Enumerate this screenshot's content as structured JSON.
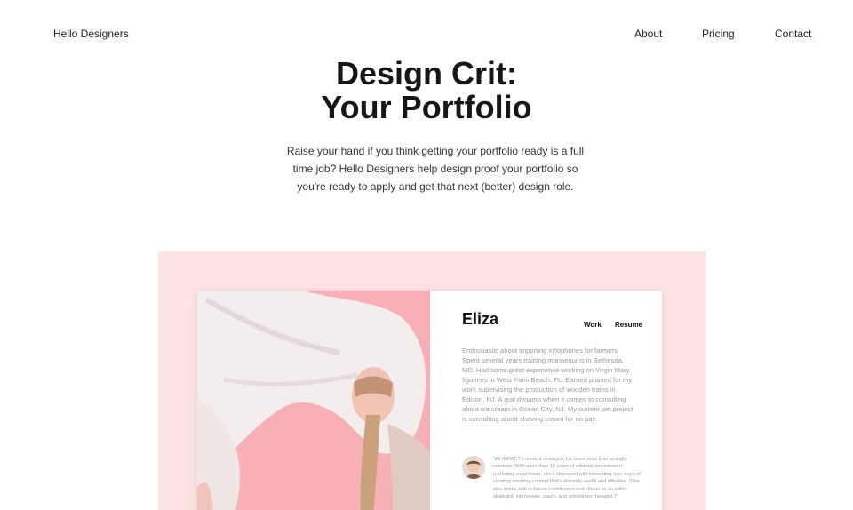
{
  "nav": {
    "brand": "Hello Designers",
    "links": [
      {
        "label": "About"
      },
      {
        "label": "Pricing"
      },
      {
        "label": "Contact"
      }
    ]
  },
  "hero": {
    "title_line1": "Design Crit:",
    "title_line2": "Your Portfolio",
    "description": "Raise your hand if you think getting your portfolio ready is a full time job? Hello Designers help design proof your portfolio so you're ready to apply and get that next (better) design role."
  },
  "preview": {
    "name": "Eliza",
    "links": [
      {
        "label": "Work"
      },
      {
        "label": "Resume"
      }
    ],
    "bio": "Enthusiastic about importing xylophones for farmers. Spent several years training mannequins in Bethesda, MD. Had some great experience working on Virgin Mary figurines in West Palm Beach, FL. Earned praised for my work supervising the production of wooden trains in Edison, NJ. A real dynamo when it comes to consulting about ice cream in Ocean City, NJ. My current pet project is consulting about shaving cream for no pay.",
    "quote": "\"As IMPACT's content strategist, Liz does more than wrangle commas. With more than 10 years of editorial and inbound marketing experience, she's obsessed with innovating new ways of creating amazing content that's absurdly useful and effective. (She also works with in-house contributors and clients as an editor, strategist, interviewer, coach, and sometimes therapist.)\""
  },
  "colors": {
    "showcase_bg": "#ffe4e4",
    "photo_bg": "#f7b3b8"
  }
}
